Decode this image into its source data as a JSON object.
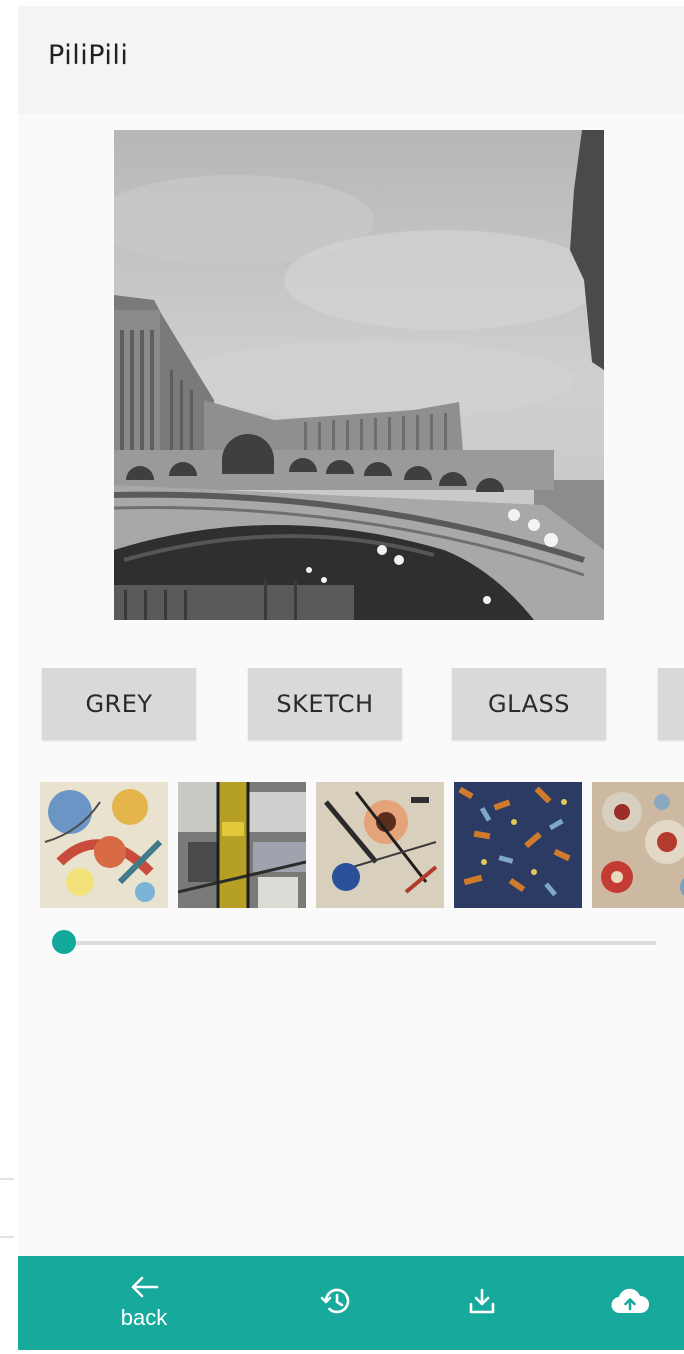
{
  "app_bar": {
    "title": "PiliPili"
  },
  "filters": [
    {
      "label": "GREY"
    },
    {
      "label": "SKETCH"
    },
    {
      "label": "GLASS"
    },
    {
      "label": ""
    }
  ],
  "style_thumbnails": [
    {
      "name": "abstract-colorful"
    },
    {
      "name": "geometric-yellow-grey"
    },
    {
      "name": "kandinsky-sketch"
    },
    {
      "name": "mosaic-blue-orange"
    },
    {
      "name": "bubbles-red"
    }
  ],
  "slider": {
    "value": 0
  },
  "bottom_nav": {
    "back_label": "back",
    "items": [
      {
        "icon": "arrow-left-icon"
      },
      {
        "icon": "history-icon"
      },
      {
        "icon": "download-icon"
      },
      {
        "icon": "cloud-upload-icon"
      }
    ]
  },
  "colors": {
    "accent": "#17a99b",
    "slider_thumb": "#13a99a",
    "filter_button": "#d9d9d9"
  }
}
